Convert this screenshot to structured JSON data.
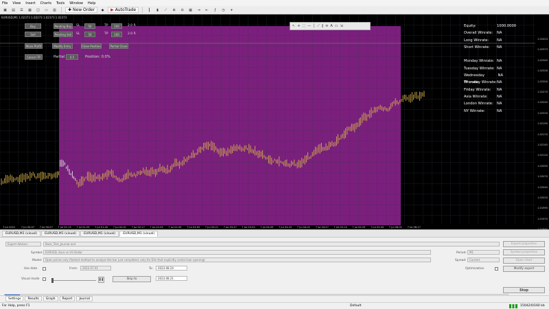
{
  "menu": [
    "File",
    "View",
    "Insert",
    "Charts",
    "Tools",
    "Window",
    "Help"
  ],
  "toolbar": {
    "new_order_label": "New Order",
    "autotrade_label": "AutoTrade"
  },
  "chart": {
    "symbol_label": "EURUSD,M1 1.02373 1.02373 1.02373 1.02373",
    "controls": {
      "buy": "Buy",
      "sell": "Sell",
      "pending_buy": "Pending Buy",
      "pending_sell": "Pending Sell",
      "sl_label": "SL",
      "tp_label": "TP",
      "buy_sl": "50",
      "buy_tp": "100",
      "sell_sl": "50",
      "sell_tp": "100",
      "buy_rr": "2.0 R",
      "sell_rr": "2.0 R",
      "breakeven": "Move Profit",
      "modify_entry": "Modify Entry",
      "close_position": "Close Position",
      "partial_close": "Partial Close",
      "cancel": "Cancel TP",
      "partial_label": "Partial",
      "partial_value": "0.5",
      "position_label": "Position: 0.0%"
    },
    "stats": [
      {
        "label": "Equity:",
        "value": "1000.0000"
      },
      {
        "label": "Overall Winrate:",
        "value": "NA"
      },
      {
        "label": "Long Winrate:",
        "value": "NA"
      },
      {
        "label": "Short Winrate:",
        "value": "NA"
      },
      {
        "label": "",
        "value": ""
      },
      {
        "label": "Monday Winrate:",
        "value": "NA"
      },
      {
        "label": "Tuesday Winrate:",
        "value": "NA"
      },
      {
        "label": "Wednesday Winrate:",
        "value": "NA"
      },
      {
        "label": "Thursday Winrate:",
        "value": "NA"
      },
      {
        "label": "Friday Winrate:",
        "value": "NA"
      },
      {
        "label": "Asia Winrate:",
        "value": "NA"
      },
      {
        "label": "London Winrate:",
        "value": "NA"
      },
      {
        "label": "NY Winrate:",
        "value": "NA"
      }
    ],
    "price_ticks": [
      "1.02423",
      "1.02373",
      "1.02345",
      "1.02326",
      "1.02300",
      "1.02270",
      "1.02245",
      "1.02220",
      "1.02195",
      "1.02170",
      "1.02145",
      "1.02120",
      "1.02095",
      "1.02070",
      "1.02045",
      "1.02020",
      "1.01995",
      "1.01970",
      "1.01945"
    ],
    "time_ticks": [
      "7 Jul 2022",
      "7 Jul 00:47",
      "7 Jul 00:57",
      "7 Jul 01:13",
      "7 Jul 01:29",
      "7 Jul 01:45",
      "7 Jul 02:01",
      "7 Jul 02:17",
      "7 Jul 02:33",
      "7 Jul 02:49",
      "7 Jul 03:05",
      "7 Jul 03:21",
      "7 Jul 03:37",
      "7 Jul 03:53",
      "7 Jul 04:09",
      "7 Jul 04:25",
      "7 Jul 04:41",
      "7 Jul 04:57",
      "7 Jul 05:13",
      "7 Jul 05:29",
      "7 Jul 05:45",
      "7 Jul 06:01",
      "7 Jul 06:17"
    ],
    "colors": {
      "background": "#000000",
      "replay_zone": "#7b1f7d",
      "candles": "#d8b44a",
      "grid": "#2c3a44"
    }
  },
  "chart_tabs": [
    "EURUSD,M1 (visual)",
    "EURUSD,M1 (visual)",
    "EURUSD,M1 (visual)",
    "EURUSD,M1 (visual)"
  ],
  "tester": {
    "type_value": "Expert Advisor",
    "ea_value": "Back_Test_Journal.ex4",
    "symbol_label": "Symbol:",
    "symbol_value": "EURUSD, Euro vs US Dollar",
    "model_label": "Model:",
    "model_value": "Open prices only (fastest method to analyze the bar just completed, only for EAs that explicitly control bar opening)",
    "use_date_label": "Use date",
    "from_label": "From:",
    "from_value": "2022.07.01",
    "to_label": "To:",
    "to_value": "2023.08.24",
    "visual_mode_label": "Visual mode",
    "skip_to_label": "Skip to",
    "skip_to_value": "2023.08.21",
    "period_label": "Period:",
    "period_value": "M1",
    "spread_label": "Spread:",
    "spread_value": "Current",
    "optimization_label": "Optimization",
    "buttons": {
      "expert_properties": "Expert properties",
      "symbol_properties": "Symbol properties",
      "open_chart": "Open chart",
      "modify_expert": "Modify expert",
      "stop": "Stop"
    },
    "progress_fraction": 0.03
  },
  "bottom_tabs": [
    "Settings",
    "Results",
    "Graph",
    "Report",
    "Journal"
  ],
  "status": {
    "help": "For Help, press F1",
    "profile": "Default",
    "connection": "15042/0/160 kb"
  }
}
